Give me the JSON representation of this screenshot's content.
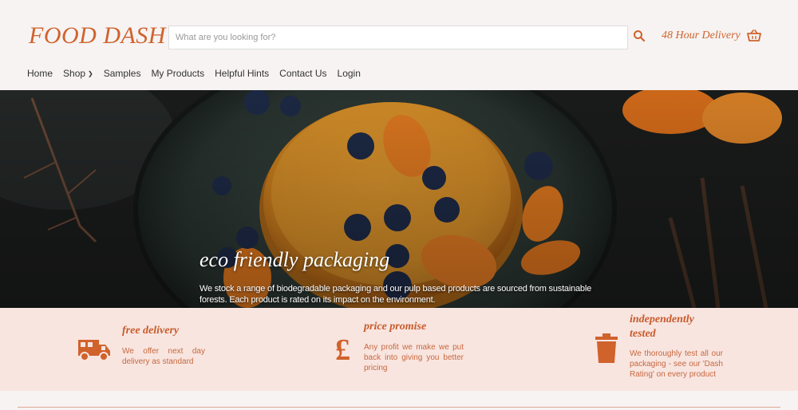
{
  "header": {
    "logo": "FOOD DASH",
    "search_placeholder": "What are you looking for?",
    "search_icon": "search-icon",
    "delivery_label": "48 Hour Delivery",
    "cart_icon": "basket-icon"
  },
  "nav": {
    "items": [
      {
        "label": "Home"
      },
      {
        "label": "Shop"
      },
      {
        "label": "Samples"
      },
      {
        "label": "My Products"
      },
      {
        "label": "Helpful Hints"
      },
      {
        "label": "Contact Us"
      },
      {
        "label": "Login"
      }
    ]
  },
  "hero": {
    "title": "eco friendly packaging",
    "text": "We stock a range of biodegradable packaging and our pulp based products are sourced from sustainable forests. Each product is rated on its impact on the environment."
  },
  "features": [
    {
      "title": "free delivery",
      "text": "We offer next day delivery as standard",
      "icon": "truck-icon"
    },
    {
      "title": "price promise",
      "text": "Any profit we make we put back into giving you better pricing",
      "icon": "pound-icon"
    },
    {
      "title": "independently tested",
      "text": "We thoroughly test all our packaging - see our 'Dash Rating' on every product",
      "icon": "bin-icon"
    }
  ],
  "colors": {
    "brand": "#d0622c",
    "feature_bg": "#f8e5e0",
    "page_bg": "#f6f3f2"
  }
}
